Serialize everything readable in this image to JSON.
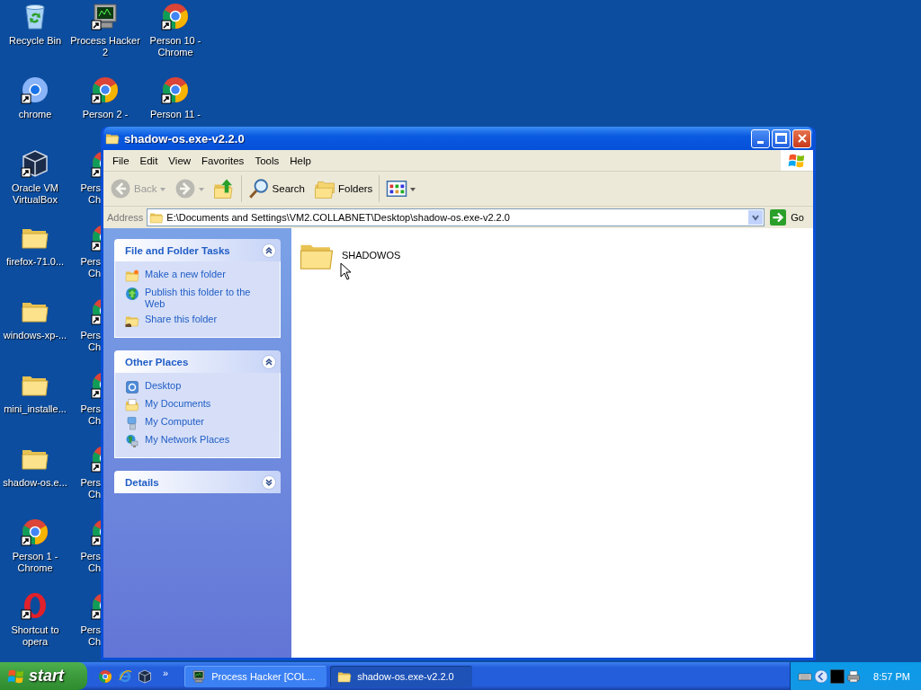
{
  "desktop": {
    "columns": [
      {
        "icons": [
          {
            "kind": "recycle",
            "label_lines": [
              "Recycle Bin"
            ],
            "shortcut": false,
            "covered": false
          },
          {
            "kind": "chrome-plain",
            "label_lines": [
              "chrome"
            ],
            "shortcut": true,
            "covered": false
          },
          {
            "kind": "cube",
            "label_lines": [
              "Oracle VM",
              "VirtualBox"
            ],
            "shortcut": true,
            "covered": false
          },
          {
            "kind": "folder",
            "label_lines": [
              "firefox-71.0..."
            ],
            "shortcut": false,
            "covered": false
          },
          {
            "kind": "folder",
            "label_lines": [
              "windows-xp-..."
            ],
            "shortcut": false,
            "covered": false
          },
          {
            "kind": "folder",
            "label_lines": [
              "mini_installe..."
            ],
            "shortcut": false,
            "covered": false
          },
          {
            "kind": "folder",
            "label_lines": [
              "shadow-os.e..."
            ],
            "shortcut": false,
            "covered": false
          },
          {
            "kind": "chrome",
            "label_lines": [
              "Person 1 -",
              "Chrome"
            ],
            "shortcut": true,
            "covered": false
          },
          {
            "kind": "opera",
            "label_lines": [
              "Shortcut to",
              "opera"
            ],
            "shortcut": true,
            "covered": false
          }
        ]
      },
      {
        "icons": [
          {
            "kind": "monitor",
            "label_lines": [
              "Process Hacker",
              "2"
            ],
            "shortcut": true,
            "covered": false
          },
          {
            "kind": "chrome",
            "label_lines": [
              "Person 2 -"
            ],
            "shortcut": true,
            "covered": false
          },
          {
            "kind": "chrome",
            "label_lines": [
              "Pers",
              "Ch"
            ],
            "shortcut": true,
            "covered": true
          },
          {
            "kind": "chrome",
            "label_lines": [
              "Pers",
              "Ch"
            ],
            "shortcut": true,
            "covered": true
          },
          {
            "kind": "chrome",
            "label_lines": [
              "Pers",
              "Ch"
            ],
            "shortcut": true,
            "covered": true
          },
          {
            "kind": "chrome",
            "label_lines": [
              "Pers",
              "Ch"
            ],
            "shortcut": true,
            "covered": true
          },
          {
            "kind": "chrome",
            "label_lines": [
              "Pers",
              "Ch"
            ],
            "shortcut": true,
            "covered": true
          },
          {
            "kind": "chrome",
            "label_lines": [
              "Pers",
              "Ch"
            ],
            "shortcut": true,
            "covered": true
          },
          {
            "kind": "chrome",
            "label_lines": [
              "Pers",
              "Ch"
            ],
            "shortcut": true,
            "covered": true
          }
        ]
      },
      {
        "icons": [
          {
            "kind": "chrome",
            "label_lines": [
              "Person 10 -",
              "Chrome"
            ],
            "shortcut": true,
            "covered": false
          },
          {
            "kind": "chrome",
            "label_lines": [
              "Person 11 -"
            ],
            "shortcut": true,
            "covered": false
          }
        ]
      }
    ]
  },
  "window": {
    "title": "shadow-os.exe-v2.2.0",
    "menu": [
      "File",
      "Edit",
      "View",
      "Favorites",
      "Tools",
      "Help"
    ],
    "toolbar": [
      {
        "kind": "back",
        "label": "Back",
        "disabled": true
      },
      {
        "kind": "forward",
        "disabled": true
      },
      {
        "kind": "up",
        "disabled": false
      },
      {
        "kind": "search",
        "label": "Search",
        "disabled": false
      },
      {
        "kind": "folders",
        "label": "Folders",
        "disabled": false
      },
      {
        "kind": "views",
        "disabled": false
      }
    ],
    "address": {
      "label": "Address",
      "value": "E:\\Documents and Settings\\VM2.COLLABNET\\Desktop\\shadow-os.exe-v2.2.0",
      "go": "Go"
    },
    "panels": [
      {
        "title": "File and Folder Tasks",
        "expanded": true,
        "items": [
          {
            "kind": "new-folder",
            "label": "Make a new folder"
          },
          {
            "kind": "globe",
            "label": "Publish this folder to the Web"
          },
          {
            "kind": "share",
            "label": "Share this folder"
          }
        ]
      },
      {
        "title": "Other Places",
        "expanded": true,
        "items": [
          {
            "kind": "desktop",
            "label": "Desktop"
          },
          {
            "kind": "documents",
            "label": "My Documents"
          },
          {
            "kind": "computer",
            "label": "My Computer"
          },
          {
            "kind": "network",
            "label": "My Network Places"
          }
        ]
      },
      {
        "title": "Details",
        "expanded": false
      }
    ],
    "files": [
      {
        "name": "SHADOWOS",
        "hovered": true
      }
    ]
  },
  "taskbar": {
    "start": "start",
    "quick_launch": [
      {
        "kind": "chrome"
      },
      {
        "kind": "ie"
      },
      {
        "kind": "cube"
      }
    ],
    "more": "»",
    "tasks": [
      {
        "kind": "monitor",
        "label": "Process Hacker [COL...",
        "selected": false
      },
      {
        "kind": "folder",
        "label": "shadow-os.exe-v2.2.0",
        "selected": true
      }
    ],
    "tray": [
      {
        "kind": "keyboard"
      },
      {
        "kind": "arrow"
      },
      {
        "kind": "console"
      },
      {
        "kind": "printer"
      }
    ],
    "clock": "8:57 PM"
  }
}
